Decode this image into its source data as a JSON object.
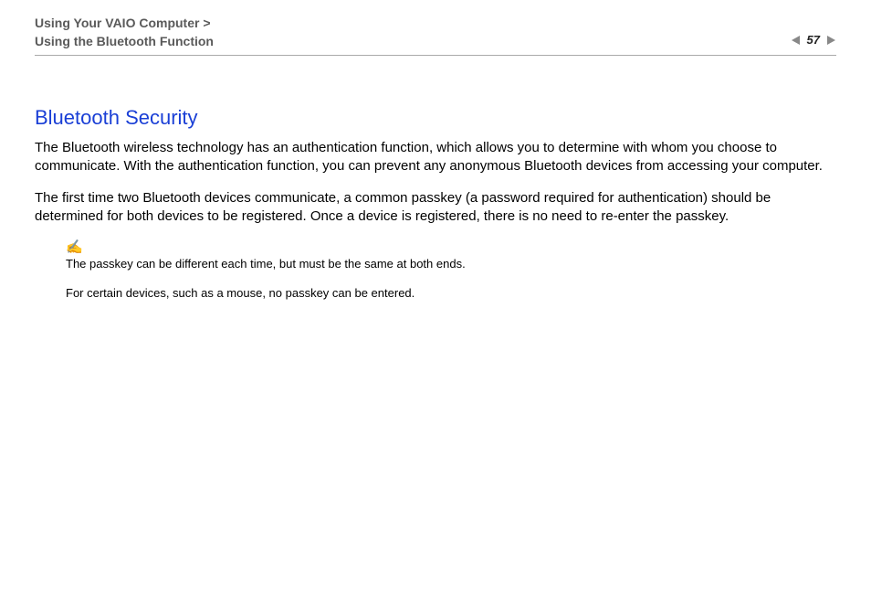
{
  "header": {
    "breadcrumb_line1": "Using Your VAIO Computer >",
    "breadcrumb_line2": "Using the Bluetooth Function",
    "page_number": "57"
  },
  "content": {
    "title": "Bluetooth Security",
    "para1": "The Bluetooth wireless technology has an authentication function, which allows you to determine with whom you choose to communicate. With the authentication function, you can prevent any anonymous Bluetooth devices from accessing your computer.",
    "para2": "The first time two Bluetooth devices communicate, a common passkey (a password required for authentication) should be determined for both devices to be registered. Once a device is registered, there is no need to re-enter the passkey.",
    "note_icon_label": "✍",
    "note1": "The passkey can be different each time, but must be the same at both ends.",
    "note2": "For certain devices, such as a mouse, no passkey can be entered."
  }
}
